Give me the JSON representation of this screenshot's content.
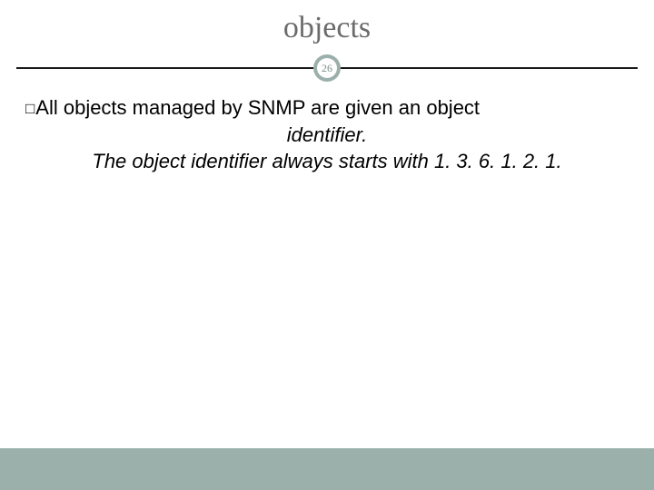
{
  "title": "objects",
  "page_number": "26",
  "bullet_glyph": "□",
  "content": {
    "line1": "All objects managed by SNMP are given an object",
    "line2": "identifier.",
    "line3": "The object identifier always starts with 1. 3. 6. 1. 2. 1."
  }
}
